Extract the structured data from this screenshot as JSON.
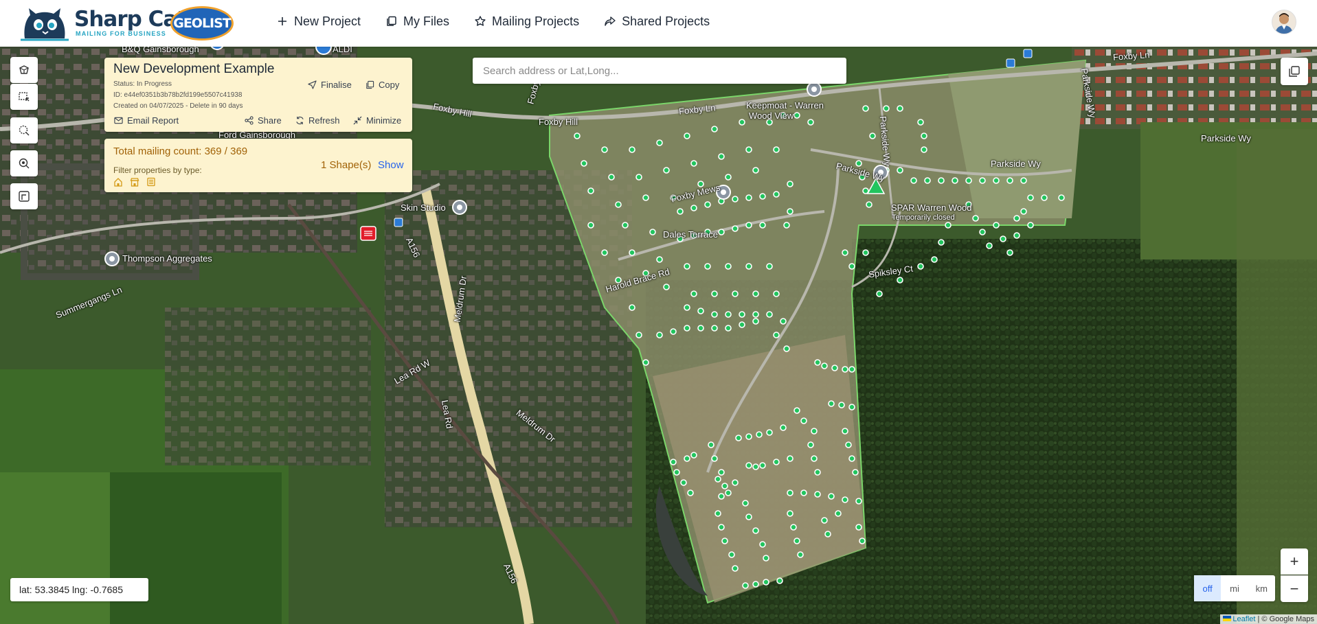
{
  "brand": {
    "name": "Sharp Cat",
    "tagline": "MAILING FOR BUSINESS",
    "badge": "GEOLIST"
  },
  "nav": {
    "new_project": "New Project",
    "my_files": "My Files",
    "mailing_projects": "Mailing Projects",
    "shared_projects": "Shared Projects"
  },
  "project": {
    "title": "New Development Example",
    "status": "Status: In Progress",
    "id": "ID: e44ef0351b3b78b2fd199e5507c41938",
    "created": "Created on 04/07/2025 - Delete in 90 days",
    "actions": {
      "finalise": "Finalise",
      "copy": "Copy",
      "email_report": "Email Report",
      "share": "Share",
      "refresh": "Refresh",
      "minimize": "Minimize"
    }
  },
  "mailing": {
    "total": "Total mailing count: 369 / 369",
    "shapes": "1 Shape(s)",
    "show": "Show",
    "filter_label": "Filter properties by type:",
    "filter_icons": [
      "house-icon",
      "shop-icon",
      "building-icon"
    ]
  },
  "search": {
    "placeholder": "Search address or Lat,Long..."
  },
  "map_labels": {
    "foxby_ln_1": "Foxby Ln",
    "foxby_ln_2": "Foxby Ln",
    "foxby_hill_1": "Foxby Hill",
    "foxby_hill_2": "Foxby Hill",
    "keepmoat": "Keepmoat - Warren",
    "wood_view": "Wood View",
    "parkside_wy_1": "Parkside Wy",
    "parkside_wy_2": "Parkside Wy",
    "parkside_wy_3": "Parkside Wy",
    "parkside_wy_vert": "Parkside Wy",
    "spar": "SPAR Warren Wood",
    "spar_status": "Temporarily closed",
    "spiksley": "Spiksley Ct",
    "foxby_mews": "Foxby Mews",
    "dales_terrace": "Dales Terrace",
    "harold_brace": "Harold Brace Rd",
    "skin_studio": "Skin Studio",
    "thompson": "Thompson Aggregates",
    "summergangs": "Summergangs Ln",
    "bq": "B&Q Gainsborough",
    "aldi": "ALDI",
    "ford": "Ford Gainsborough",
    "a156_1": "A156",
    "a156_2": "A156",
    "meldrum_1": "Meldrum Dr",
    "meldrum_2": "Meldrum Dr",
    "lea_rd_w": "Lea Rd W",
    "lea_rd": "Lea Rd"
  },
  "coords": {
    "text": "lat: 53.3845 lng: -0.7685"
  },
  "units": {
    "off": "off",
    "mi": "mi",
    "km": "km",
    "selected": "off"
  },
  "zoom": {
    "in": "+",
    "out": "−"
  },
  "attribution": {
    "leaflet": "Leaflet",
    "rest": " | © Google Maps"
  },
  "colors": {
    "accent": "#2563eb",
    "panel_bg": "#fdf3cf",
    "panel_text": "#a16207",
    "marker": "#22c55e",
    "shape": "#7bd66a"
  }
}
